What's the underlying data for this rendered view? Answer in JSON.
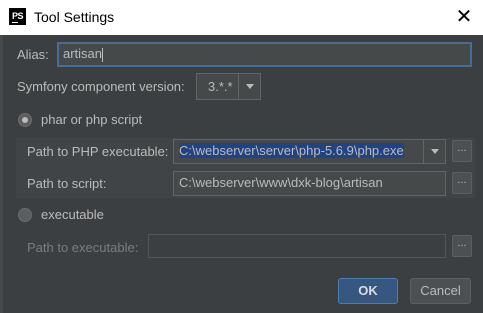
{
  "window": {
    "title": "Tool Settings",
    "app_icon": "PS"
  },
  "alias": {
    "label": "Alias:",
    "value": "artisan"
  },
  "symfony": {
    "label": "Symfony component version:",
    "value": "3.*.*"
  },
  "options": {
    "phar_label": "phar or php script",
    "php_path_label": "Path to PHP executable:",
    "php_path_value": "C:\\webserver\\server\\php-5.6.9\\php.exe",
    "script_label": "Path to script:",
    "script_value": "C:\\webserver\\www\\dxk-blog\\artisan",
    "executable_label": "executable",
    "exec_path_label": "Path to executable:",
    "exec_path_value": ""
  },
  "buttons": {
    "ok": "OK",
    "cancel": "Cancel",
    "browse": "..."
  },
  "icons": {
    "close": "close-icon",
    "dropdown": "chevron-down-icon",
    "app": "phpstorm-icon"
  },
  "colors": {
    "background": "#3c3f41",
    "accent": "#365880",
    "selection": "#214283",
    "focus_border": "#466d94"
  }
}
